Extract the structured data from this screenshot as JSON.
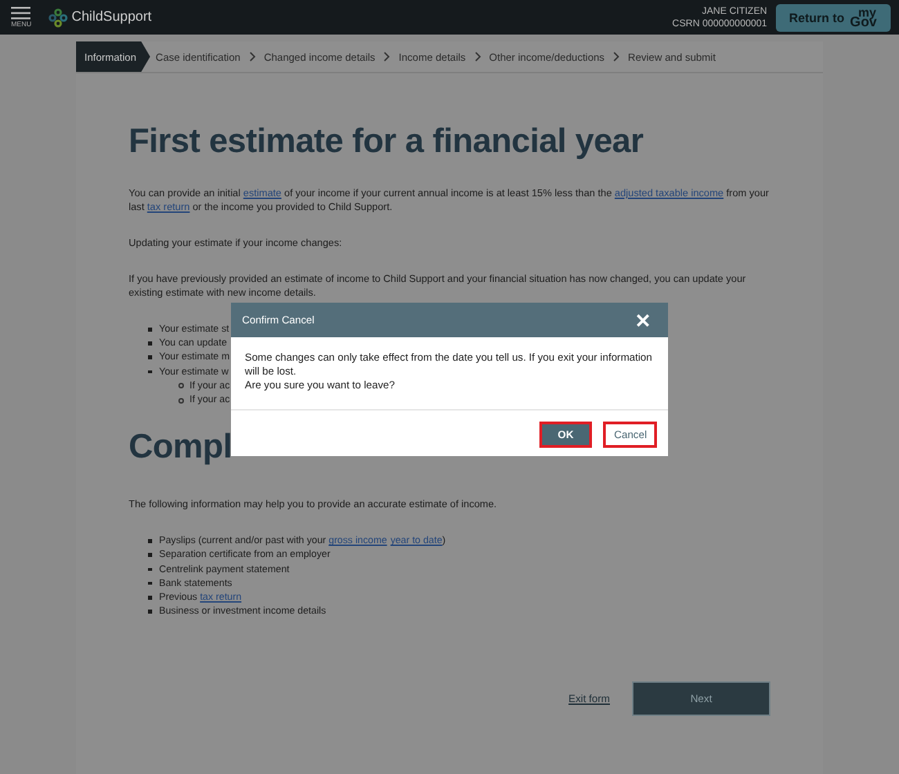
{
  "header": {
    "menu_label": "MENU",
    "brand": "ChildSupport",
    "user_name": "JANE CITIZEN",
    "csrn": "CSRN 000000000001",
    "return_button": {
      "label": "Return to",
      "logo_top": "my",
      "logo_bottom": "Gov"
    }
  },
  "steps": [
    {
      "label": "Information",
      "selected": true
    },
    {
      "label": "Case identification",
      "selected": false
    },
    {
      "label": "Changed income details",
      "selected": false
    },
    {
      "label": "Income details",
      "selected": false
    },
    {
      "label": "Other income/deductions",
      "selected": false
    },
    {
      "label": "Review and submit",
      "selected": false
    }
  ],
  "content": [
    {
      "kind": "heading",
      "text": "First estimate for a financial year"
    },
    {
      "kind": "paragraph",
      "segments": [
        {
          "kind": "text",
          "text": "You can provide an initial "
        },
        {
          "kind": "link",
          "text": "estimate"
        },
        {
          "kind": "text",
          "text": " of your income if your current annual income is at least 15% less than the "
        },
        {
          "kind": "link",
          "text": "adjusted taxable income"
        },
        {
          "kind": "text",
          "text": " from your last "
        },
        {
          "kind": "link",
          "text": "tax return"
        },
        {
          "kind": "text",
          "text": " or the income you provided to Child Support."
        }
      ]
    },
    {
      "kind": "paragraph",
      "segments": [
        {
          "kind": "text",
          "text": "Updating your estimate if your income changes:"
        }
      ]
    },
    {
      "kind": "paragraph",
      "segments": [
        {
          "kind": "text",
          "text": "If you have previously provided an estimate of income to Child Support and your financial situation has now changed, you can update your existing estimate with new income details."
        }
      ]
    },
    {
      "kind": "list",
      "items": [
        {
          "segments": [
            {
              "kind": "text",
              "text": "Your estimate st"
            }
          ]
        },
        {
          "segments": [
            {
              "kind": "text",
              "text": "You can update"
            }
          ]
        },
        {
          "segments": [
            {
              "kind": "text",
              "text": "Your estimate m"
            }
          ]
        },
        {
          "segments": [
            {
              "kind": "text",
              "text": "Your estimate w"
            }
          ],
          "children": [
            {
              "segments": [
                {
                  "kind": "text",
                  "text": "If your ac"
                }
              ]
            },
            {
              "segments": [
                {
                  "kind": "text",
                  "text": "If your ac"
                }
              ]
            }
          ]
        }
      ]
    },
    {
      "kind": "heading",
      "text": "Compl"
    },
    {
      "kind": "paragraph",
      "segments": [
        {
          "kind": "text",
          "text": "The following information may help you to provide an accurate estimate of income."
        }
      ]
    },
    {
      "kind": "list",
      "items": [
        {
          "segments": [
            {
              "kind": "text",
              "text": "Payslips (current and/or past with your "
            },
            {
              "kind": "link",
              "text": "gross income"
            },
            {
              "kind": "link",
              "text": "year to date",
              "gap_before": true
            },
            {
              "kind": "text",
              "text": ")"
            }
          ]
        },
        {
          "segments": [
            {
              "kind": "text",
              "text": "Separation certificate from an employer"
            }
          ]
        },
        {
          "segments": [
            {
              "kind": "text",
              "text": "Centrelink payment statement"
            }
          ]
        },
        {
          "segments": [
            {
              "kind": "text",
              "text": "Bank statements"
            }
          ]
        },
        {
          "segments": [
            {
              "kind": "text",
              "text": "Previous "
            },
            {
              "kind": "link",
              "text": "tax return"
            }
          ]
        },
        {
          "segments": [
            {
              "kind": "text",
              "text": "Business or investment income details"
            }
          ]
        }
      ]
    }
  ],
  "actions": {
    "exit_link": "Exit form",
    "next_button": "Next"
  },
  "dialog": {
    "title": "Confirm Cancel",
    "close": "✕",
    "message_lines": [
      "Some changes can only take effect from the date you tell us. If you exit your information will be lost.",
      "Are you sure you want to leave?"
    ],
    "buttons": [
      {
        "label": "OK",
        "kind": "primary"
      },
      {
        "label": "Cancel",
        "kind": "secondary"
      }
    ]
  }
}
